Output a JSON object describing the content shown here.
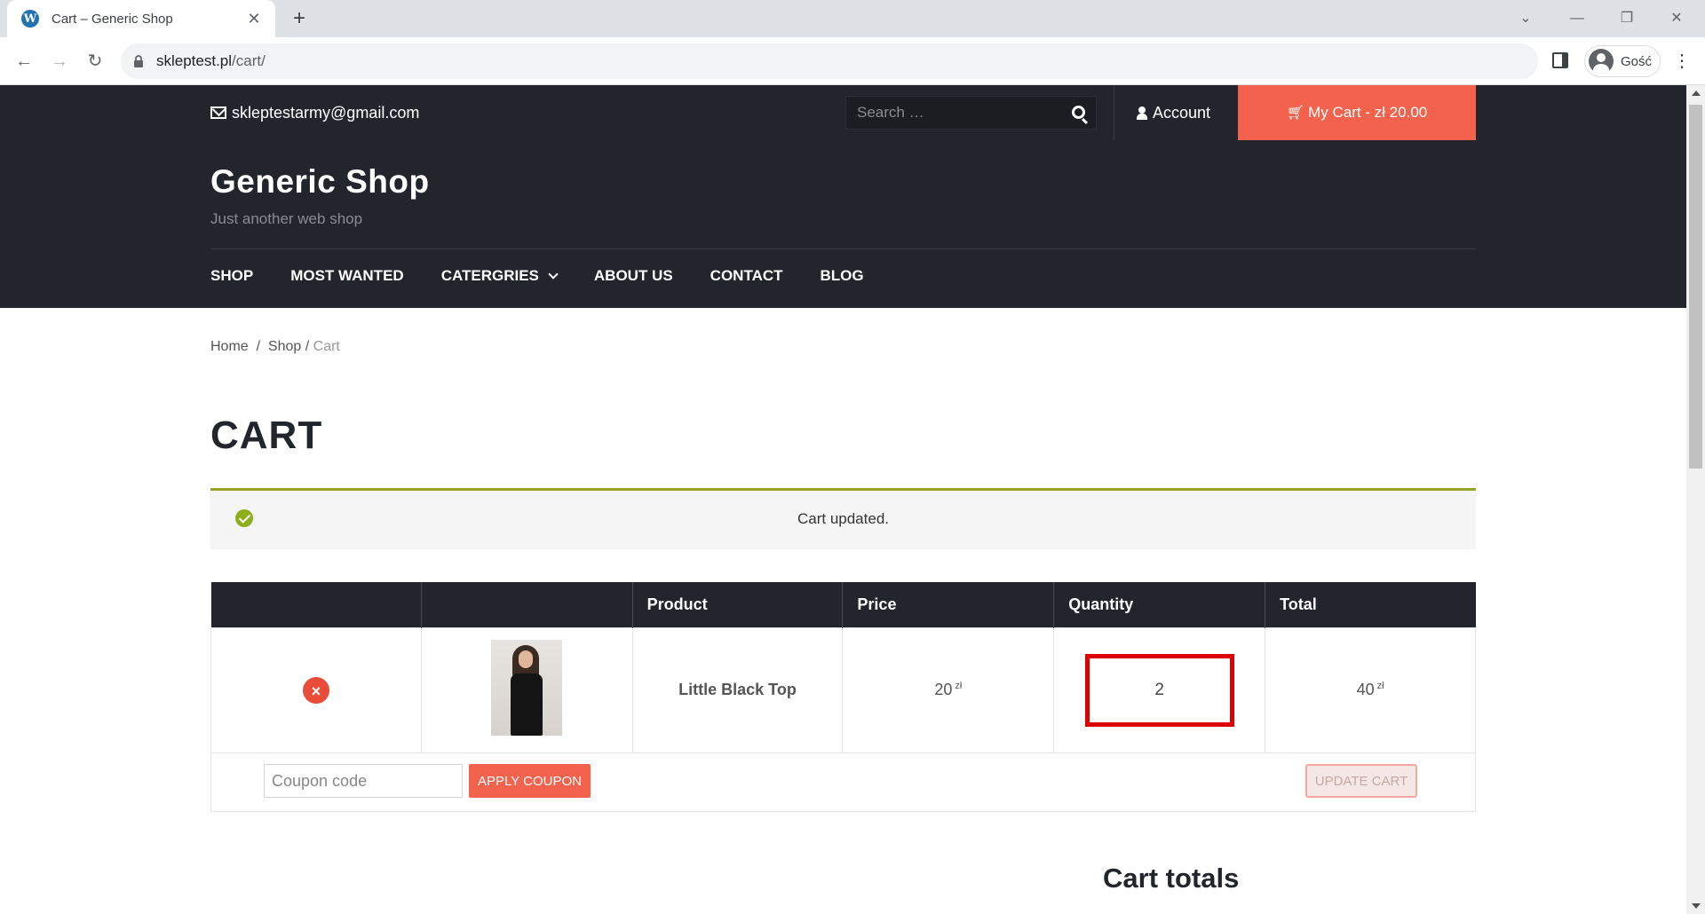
{
  "browser": {
    "tab_title": "Cart – Generic Shop",
    "url_host": "skleptest.pl",
    "url_path": "/cart/",
    "profile_name": "Gość"
  },
  "topbar": {
    "email": "skleptestarmy@gmail.com",
    "search_placeholder": "Search …",
    "account_label": "Account",
    "cart_label": "My Cart - zł 20.00"
  },
  "header": {
    "site_title": "Generic Shop",
    "tagline": "Just another web shop",
    "menu": [
      "SHOP",
      "MOST WANTED",
      "CATERGRIES",
      "ABOUT US",
      "CONTACT",
      "BLOG"
    ]
  },
  "breadcrumb": {
    "home": "Home",
    "shop": "Shop",
    "current": "Cart"
  },
  "page_title": "CART",
  "notice": "Cart updated.",
  "cart": {
    "headers": [
      "",
      "",
      "Product",
      "Price",
      "Quantity",
      "Total"
    ],
    "item": {
      "remove": "×",
      "name": "Little Black Top",
      "price": "20",
      "price_currency": "zł",
      "quantity": "2",
      "total": "40",
      "total_currency": "zł"
    },
    "coupon_placeholder": "Coupon code",
    "apply_label": "APPLY COUPON",
    "update_label": "UPDATE CART"
  },
  "totals_heading": "Cart totals",
  "colors": {
    "accent": "#f2624d",
    "dark": "#23252d",
    "success": "#8fae1b",
    "highlight": "#dd0000"
  }
}
